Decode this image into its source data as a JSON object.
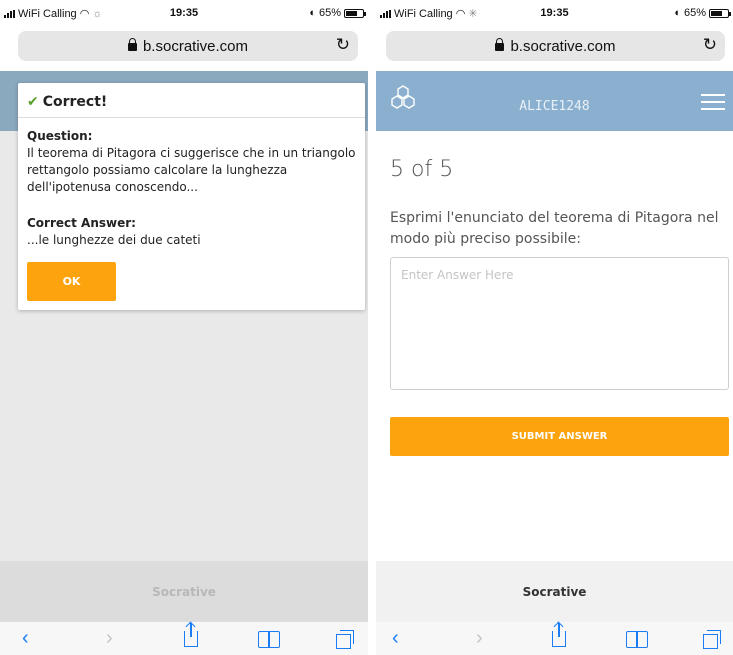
{
  "left_phone": {
    "status": {
      "carrier": "WiFi Calling",
      "time": "19:35",
      "battery": "65%"
    },
    "browser": {
      "url": "b.socrative.com"
    },
    "modal": {
      "title": "Correct!",
      "question_label": "Question:",
      "question_text": "Il teorema di Pitagora ci suggerisce che in un triangolo rettangolo possiamo calcolare la lunghezza dell'ipotenusa conoscendo...",
      "answer_label": "Correct Answer:",
      "answer_text": "...le lunghezze dei due cateti",
      "ok_label": "OK"
    },
    "footer": {
      "brand": "Socrative"
    }
  },
  "right_phone": {
    "status": {
      "carrier": "WiFi Calling",
      "time": "19:35",
      "battery": "65%"
    },
    "browser": {
      "url": "b.socrative.com"
    },
    "header": {
      "room_name": "ALICE1248"
    },
    "quiz": {
      "progress": "5 of 5",
      "question": "Esprimi l'enunciato del teorema di Pitagora nel modo più preciso possibile:",
      "answer_value": "",
      "answer_placeholder": "Enter Answer Here",
      "submit_label": "SUBMIT ANSWER"
    },
    "footer": {
      "brand": "Socrative"
    }
  },
  "colors": {
    "accent_orange": "#fca30e",
    "header_blue": "#8aafcf",
    "safari_blue": "#1a7cf5",
    "correct_green": "#5aa02c"
  },
  "icons": [
    "signal-icon",
    "wifi-icon",
    "alarm-icon",
    "battery-icon",
    "lock-icon",
    "reload-icon",
    "check-icon",
    "socrative-logo-icon",
    "hamburger-menu-icon",
    "back-icon",
    "forward-icon",
    "share-icon",
    "bookmarks-icon",
    "tabs-icon"
  ]
}
